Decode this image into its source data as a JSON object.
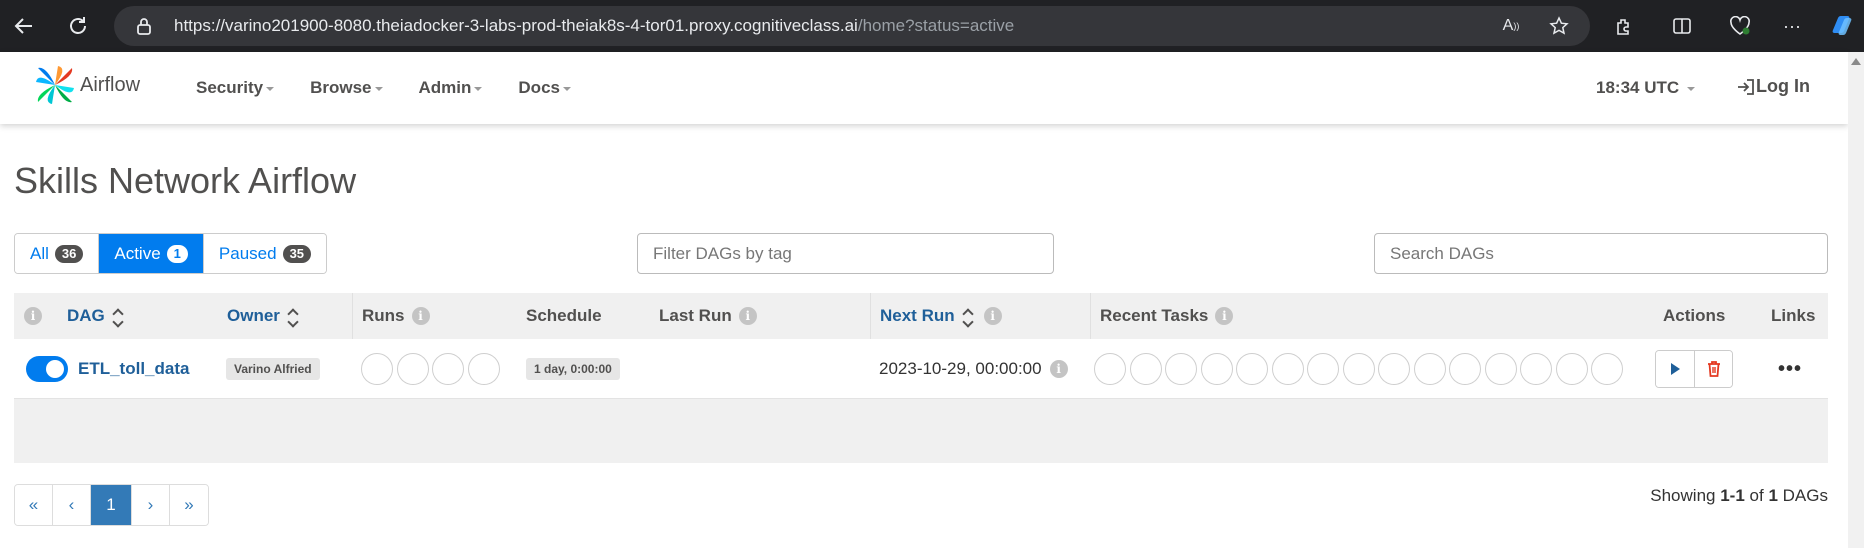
{
  "browser": {
    "url_host": "https://varino201900-8080.theiadocker-3-labs-prod-theiak8s-4-tor01.proxy.cognitiveclass.ai",
    "url_path": "/home?status=active"
  },
  "navbar": {
    "brand": "Airflow",
    "menu": [
      {
        "label": "Security"
      },
      {
        "label": "Browse"
      },
      {
        "label": "Admin"
      },
      {
        "label": "Docs"
      }
    ],
    "clock": "18:34 UTC",
    "login": "Log In"
  },
  "page": {
    "title": "Skills Network Airflow"
  },
  "filters": {
    "all_label": "All",
    "all_count": "36",
    "active_label": "Active",
    "active_count": "1",
    "paused_label": "Paused",
    "paused_count": "35",
    "selected": "Active"
  },
  "tag_filter": {
    "placeholder": "Filter DAGs by tag"
  },
  "search": {
    "placeholder": "Search DAGs"
  },
  "table": {
    "headers": {
      "dag": "DAG",
      "owner": "Owner",
      "runs": "Runs",
      "schedule": "Schedule",
      "last_run": "Last Run",
      "next_run": "Next Run",
      "recent_tasks": "Recent Tasks",
      "actions": "Actions",
      "links": "Links"
    },
    "rows": [
      {
        "active": true,
        "dag_id": "ETL_toll_data",
        "owner": "Varino Alfried",
        "schedule": "1 day, 0:00:00",
        "last_run": "",
        "next_run": "2023-10-29, 00:00:00",
        "links": "•••"
      }
    ]
  },
  "pagination": {
    "first": "«",
    "prev": "‹",
    "current": "1",
    "next": "›",
    "last": "»"
  },
  "showing": {
    "prefix": "Showing",
    "range": "1-1",
    "of": "of",
    "total": "1",
    "suffix": "DAGs"
  },
  "colors": {
    "accent": "#017cee",
    "link": "#1f5f99",
    "delete": "#e43921"
  }
}
